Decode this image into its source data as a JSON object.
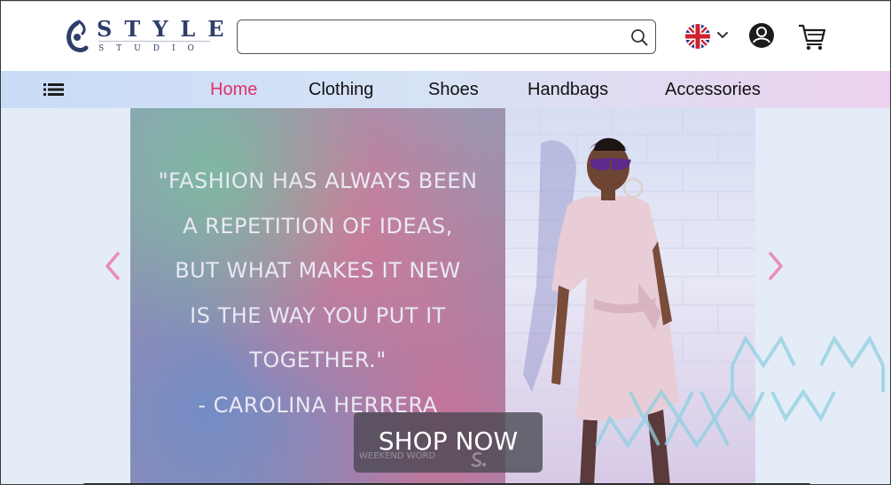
{
  "brand": {
    "name": "STYLE",
    "sub": "STUDIO"
  },
  "search": {
    "value": "",
    "placeholder": ""
  },
  "header_icons": [
    "search-icon",
    "uk-flag-icon",
    "chevron-down-icon",
    "account-icon",
    "cart-icon"
  ],
  "nav": {
    "items": [
      {
        "label": "Home",
        "active": true
      },
      {
        "label": "Clothing",
        "active": false
      },
      {
        "label": "Shoes",
        "active": false
      },
      {
        "label": "Handbags",
        "active": false
      },
      {
        "label": "Accessories",
        "active": false
      }
    ]
  },
  "hero": {
    "quote_lines": [
      "\"FASHION HAS ALWAYS BEEN",
      "A REPETITION OF IDEAS,",
      "BUT WHAT MAKES IT NEW",
      "IS THE WAY YOU PUT IT",
      "TOGETHER.\"",
      "- CAROLINA HERRERA"
    ],
    "cta_label": "SHOP NOW",
    "cta_sub": "WEEKEND WORD"
  },
  "colors": {
    "accent": "#e2306c",
    "brand": "#2f3d6a",
    "arrow": "#e98bb8"
  }
}
